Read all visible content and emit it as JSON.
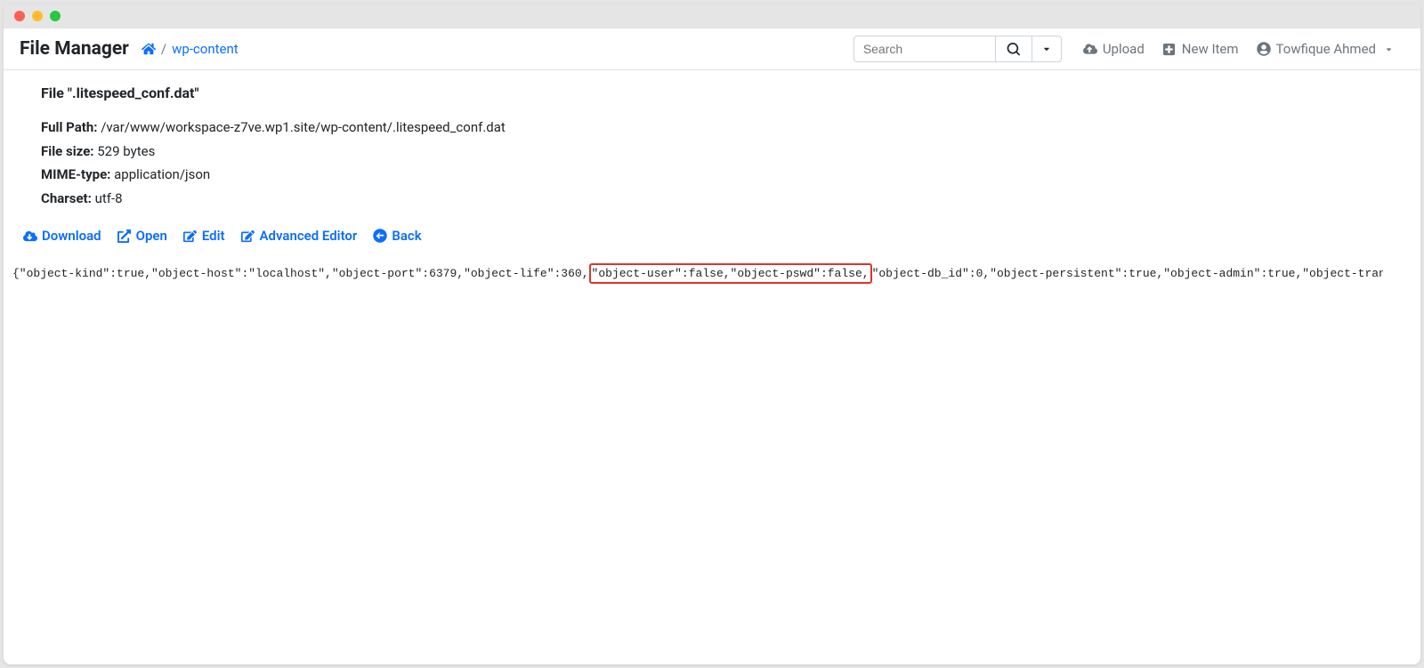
{
  "app": {
    "title": "File Manager"
  },
  "breadcrumb": {
    "path_label": "wp-content"
  },
  "search": {
    "placeholder": "Search"
  },
  "nav": {
    "upload": "Upload",
    "new_item": "New Item",
    "user": "Towfique Ahmed"
  },
  "file": {
    "header_prefix": "File ",
    "filename_quoted": "\".litespeed_conf.dat\"",
    "full_path_label": "Full Path:",
    "full_path_value": " /var/www/workspace-z7ve.wp1.site/wp-content/.litespeed_conf.dat",
    "file_size_label": "File size:",
    "file_size_value": " 529 bytes",
    "mime_label": "MIME-type:",
    "mime_value": " application/json",
    "charset_label": "Charset:",
    "charset_value": " utf-8"
  },
  "actions": {
    "download": "Download",
    "open": "Open",
    "edit": "Edit",
    "advanced_editor": "Advanced Editor",
    "back": "Back"
  },
  "content": {
    "part1": "{\"object-kind\":true,\"object-host\":\"localhost\",\"object-port\":6379,\"object-life\":360,",
    "highlighted": "\"object-user\":false,\"object-pswd\":false,",
    "part2": "\"object-db_id\":0,\"object-persistent\":true,\"object-admin\":true,\"object-transients\":true,"
  }
}
